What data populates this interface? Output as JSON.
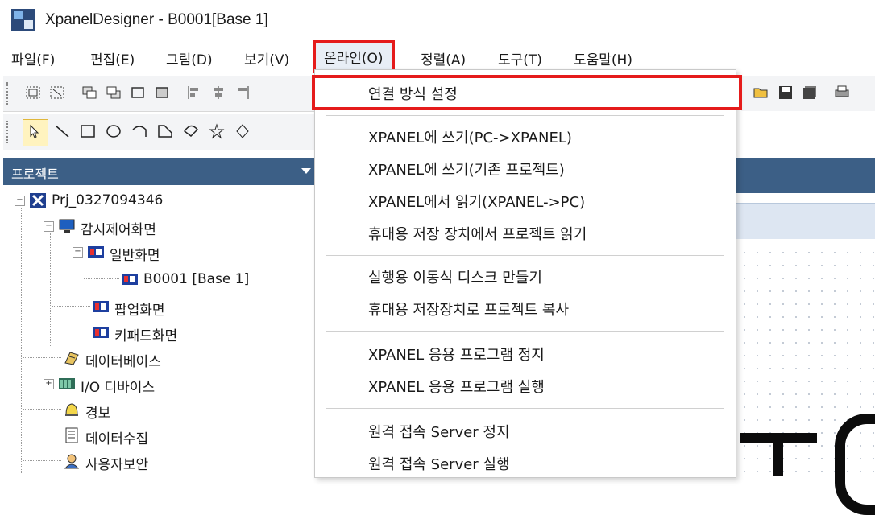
{
  "window": {
    "title": "XpanelDesigner - B0001[Base 1]"
  },
  "menu": [
    {
      "label": "파일(F)"
    },
    {
      "label": "편집(E)"
    },
    {
      "label": "그림(D)"
    },
    {
      "label": "보기(V)"
    },
    {
      "label": "온라인(O)"
    },
    {
      "label": "정렬(A)"
    },
    {
      "label": "도구(T)"
    },
    {
      "label": "도움말(H)"
    }
  ],
  "panel": {
    "title": "프로젝트"
  },
  "tree": {
    "project": "Prj_0327094346",
    "monitor": "감시제어화면",
    "general": "일반화면",
    "base": "B0001 [Base 1]",
    "popup": "팝업화면",
    "keypad": "키패드화면",
    "database": "데이터베이스",
    "io": "I/O 디바이스",
    "alarm": "경보",
    "datacollect": "데이터수집",
    "security": "사용자보안"
  },
  "dropdown": {
    "items": [
      "연결 방식 설정",
      "XPANEL에 쓰기(PC->XPANEL)",
      "XPANEL에 쓰기(기존 프로젝트)",
      "XPANEL에서 읽기(XPANEL->PC)",
      "휴대용 저장 장치에서 프로젝트 읽기",
      "실행용 이동식 디스크 만들기",
      "휴대용 저장장치로 프로젝트 복사",
      "XPANEL 응용 프로그램 정지",
      "XPANEL 응용 프로그램 실행",
      "원격 접속 Server 정지",
      "원격 접속 Server 실행"
    ]
  },
  "colors": {
    "highlight": "#e51b1b",
    "panel_header": "#3c5f86"
  }
}
